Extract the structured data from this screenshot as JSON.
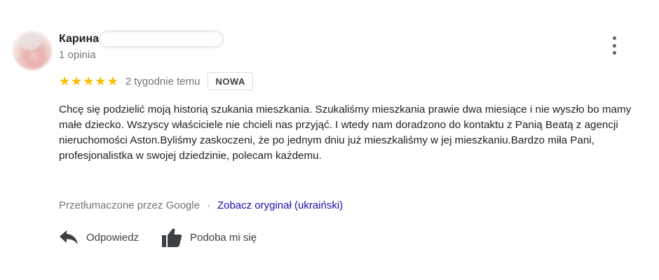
{
  "reviewer": {
    "name": "Карина",
    "review_count": "1 opinia"
  },
  "rating": {
    "stars": 5,
    "max": 5,
    "star_color": "#fbbc04"
  },
  "meta": {
    "date": "2 tygodnie temu",
    "badge": "NOWA"
  },
  "review_text": "Chcę się podzielić moją historią szukania mieszkania. Szukaliśmy mieszkania prawie dwa miesiące i nie wyszło bo mamy małe dziecko. Wszyscy właściciele nie chcieli nas przyjąć. I wtedy nam doradzono do kontaktu z Panią Beatą z agencji nieruchomości Aston.Byliśmy zaskoczeni, że po jednym dniu już mieszkaliśmy w jej mieszkaniu.Bardzo miła Pani, profesjonalistka w swojej dziedzinie, polecam każdemu.",
  "translation": {
    "note": "Przetłumaczone przez Google",
    "separator": "·",
    "link": "Zobacz oryginał (ukraiński)",
    "link_color": "#1a0dab"
  },
  "actions": {
    "reply_label": "Odpowiedz",
    "like_label": "Podoba mi się"
  },
  "icons": {
    "menu": "more-vert-icon",
    "reply": "reply-arrow-icon",
    "like": "thumbs-up-icon",
    "star": "star-icon"
  }
}
